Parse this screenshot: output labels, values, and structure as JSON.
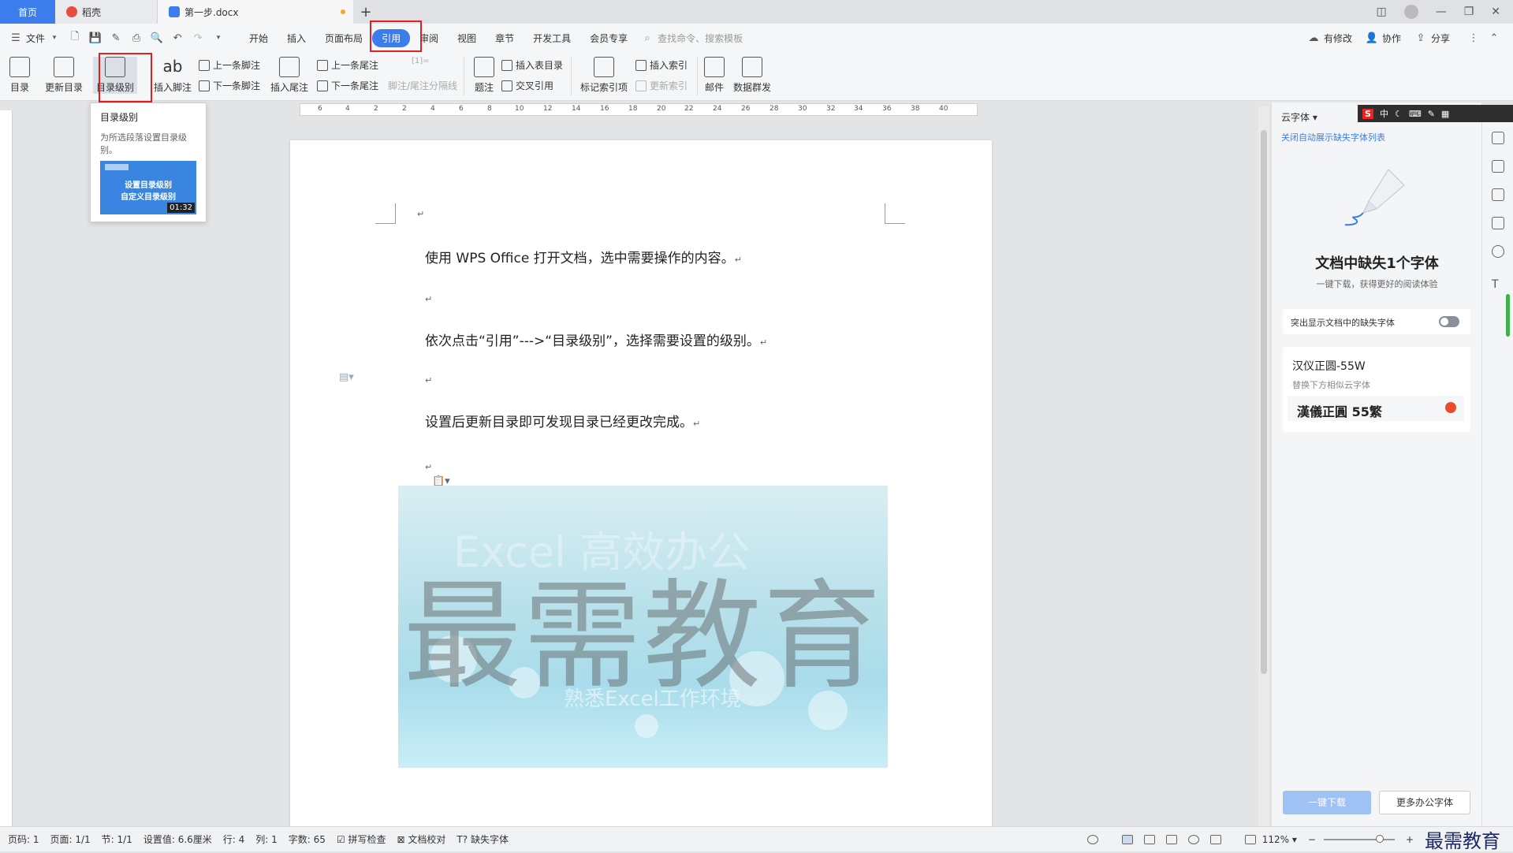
{
  "tabs": {
    "home": "首页",
    "daoke": "稻壳",
    "doc": "第一步.docx",
    "new_tab": "+"
  },
  "menu": {
    "file": "文件",
    "items": [
      "开始",
      "插入",
      "页面布局",
      "引用",
      "审阅",
      "视图",
      "章节",
      "开发工具",
      "会员专享"
    ],
    "search_placeholder": "查找命令、搜索模板",
    "right": [
      "有修改",
      "协作",
      "分享"
    ]
  },
  "ribbon": {
    "toc": "目录",
    "update_toc": "更新目录",
    "toc_level": "目录级别",
    "insert_footnote": "插入脚注",
    "prev_footnote": "上一条脚注",
    "next_footnote": "下一条脚注",
    "insert_endnote": "插入尾注",
    "prev_endnote": "上一条尾注",
    "next_endnote": "下一条尾注",
    "footnote_sep": "脚注/尾注分隔线",
    "caption": "题注",
    "insert_table_of_figures": "插入表目录",
    "cross_ref": "交叉引用",
    "mark_index": "标记索引项",
    "insert_index": "插入索引",
    "update_index": "更新索引",
    "mail": "邮件",
    "mail_merge": "数据群发"
  },
  "tooltip": {
    "title": "目录级别",
    "desc": "为所选段落设置目录级别。",
    "video_line1": "设置目录级别",
    "video_line2": "自定义目录级别",
    "video_time": "01:32"
  },
  "ruler": {
    "ticks": [
      "6",
      "4",
      "2",
      "2",
      "4",
      "6",
      "8",
      "10",
      "12",
      "14",
      "16",
      "18",
      "20",
      "22",
      "24",
      "26",
      "28",
      "30",
      "32",
      "34",
      "36",
      "38",
      "40"
    ]
  },
  "document": {
    "p1": "使用 WPS Office 打开文档，选中需要操作的内容。",
    "p2": "依次点击“引用”--->“目录级别”，选择需要设置的级别。",
    "p3": "设置后更新目录即可发现目录已经更改完成。",
    "return_mark": "↵",
    "image_watermark": "最需教育",
    "image_text_top": "Excel 高效办公",
    "image_text_bottom": "熟悉Excel工作环境"
  },
  "right_panel": {
    "font_cloud": "云字体",
    "close_link": "关闭自动展示缺失字体列表",
    "missing_title": "文档中缺失1个字体",
    "missing_sub": "一键下载，获得更好的阅读体验",
    "highlight_label": "突出显示文档中的缺失字体",
    "font_name": "汉仪正圆-55W",
    "replace_hint": "替换下方相似云字体",
    "cloud_font": "漢儀正圓 55繁",
    "download_btn": "一键下载",
    "more_btn": "更多办公字体"
  },
  "ime": {
    "label": "中"
  },
  "status": {
    "page": "页码: 1",
    "pages": "页面: 1/1",
    "section": "节: 1/1",
    "setting": "设置值: 6.6厘米",
    "row": "行: 4",
    "col": "列: 1",
    "words": "字数: 65",
    "spell": "拼写检查",
    "proof": "文档校对",
    "missing_font": "缺失字体",
    "zoom": "112%",
    "watermark": "最需教育"
  }
}
